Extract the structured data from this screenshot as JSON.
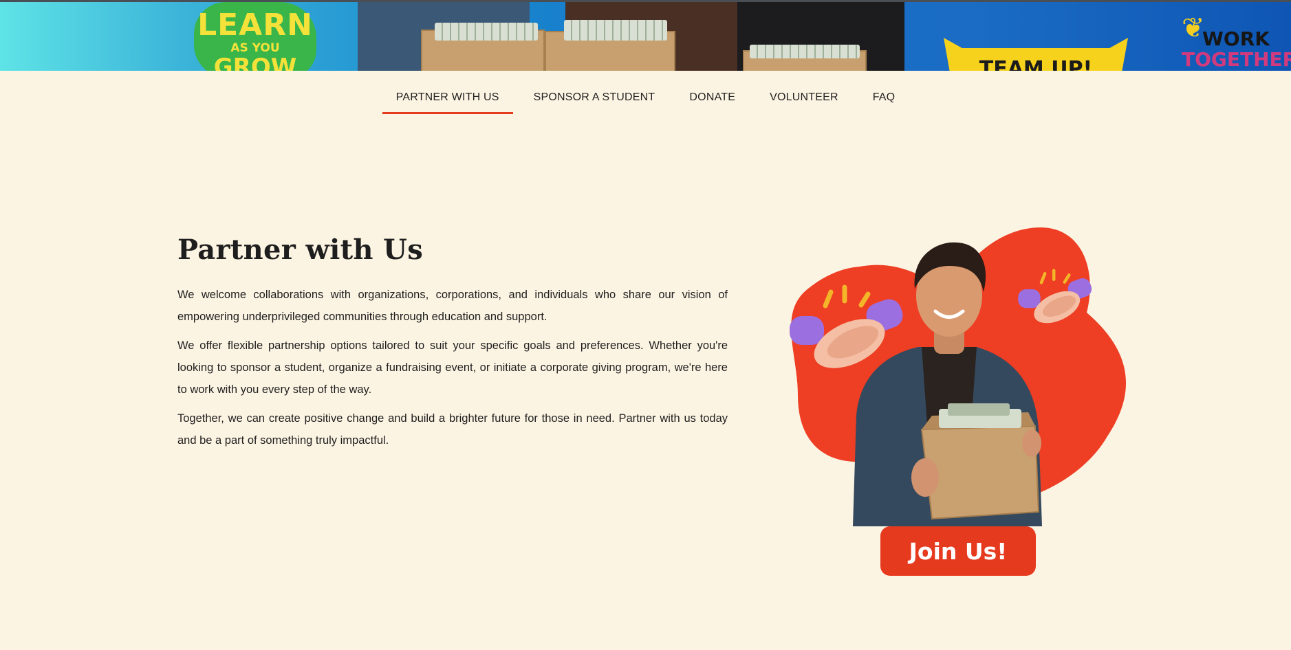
{
  "banner": {
    "sticker_learn": {
      "line1": "LEARN",
      "line2": "AS YOU",
      "line3": "GROW"
    },
    "sticker_team": "TEAM UP!",
    "sticker_work": {
      "line1": "WORK",
      "line2": "TOGETHER"
    }
  },
  "nav": {
    "items": [
      {
        "label": "PARTNER WITH US",
        "active": true
      },
      {
        "label": "SPONSOR A STUDENT",
        "active": false
      },
      {
        "label": "DONATE",
        "active": false
      },
      {
        "label": "VOLUNTEER",
        "active": false
      },
      {
        "label": "FAQ",
        "active": false
      }
    ]
  },
  "main": {
    "title": "Partner with Us",
    "paragraphs": [
      "We welcome collaborations with organizations, corporations, and individuals who share our vision of empowering underprivileged communities through education and support.",
      "We offer flexible partnership options tailored to suit your specific goals and preferences. Whether you're looking to sponsor a student, organize a fundraising event, or initiate a corporate giving program, we're here to work with you every step of the way.",
      "Together, we can create positive change and build a brighter future for those in need. Partner with us today and be a part of something truly impactful."
    ],
    "cta_label": "Join Us!"
  },
  "colors": {
    "accent": "#e63a1f",
    "background": "#fcf4e3",
    "text": "#1e1e1e"
  },
  "icons": [
    "handshake-icon",
    "handshake-icon"
  ]
}
